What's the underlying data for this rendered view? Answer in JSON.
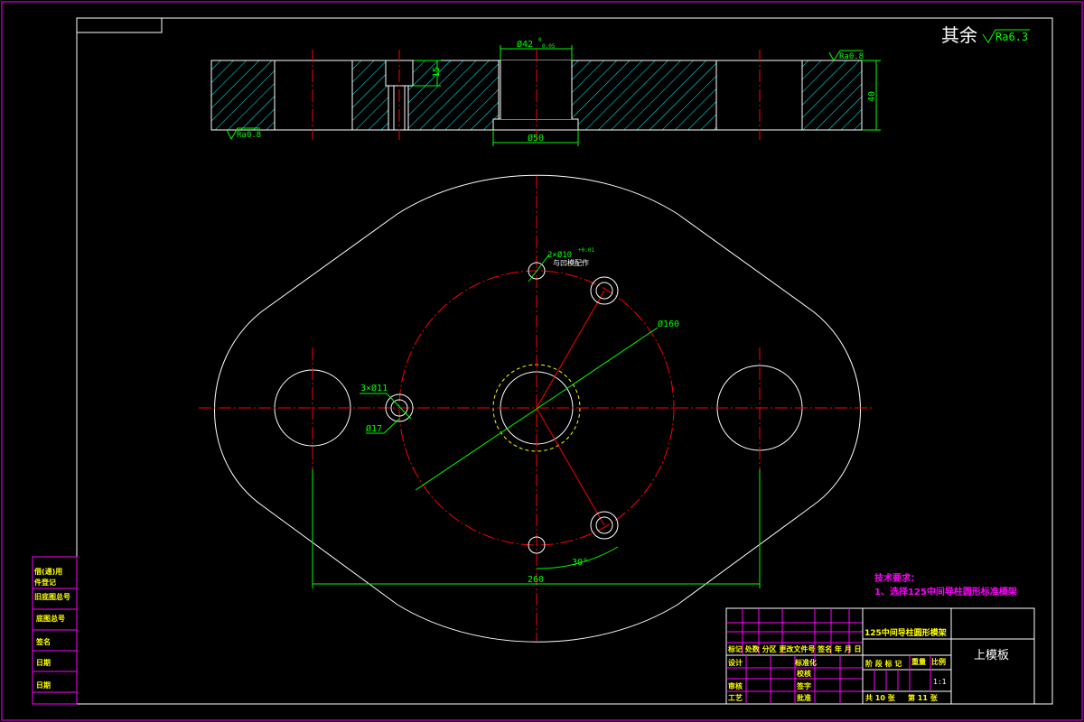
{
  "header": {
    "roughness_other_prefix": "其余",
    "roughness_other_value": "Ra6.3"
  },
  "section_view": {
    "bore_top_dim": "Ø42",
    "bore_top_tol_upper": "0",
    "bore_top_tol_lower": "0.05",
    "counterbore_depth": "15",
    "thickness": "40",
    "bottom_step_dim": "Ø50",
    "roughness_left": "Ra0.8",
    "roughness_right": "Ra0.8"
  },
  "plan_view": {
    "pin_hole_note": "2×Ø10",
    "pin_hole_tol": "+0.01",
    "pin_hole_note2": "与凹模配作",
    "pitch_circle": "Ø160",
    "screw_holes": "3×Ø11",
    "counterbore": "Ø17",
    "angle": "30°",
    "center_distance": "260"
  },
  "tech_requirements": {
    "title": "技术要求：",
    "item1": "1、选择125中间导柱圆形标准模架"
  },
  "title_block": {
    "part_name": "上模板",
    "standard_note": "125中间导柱圆形模架",
    "scale_label": "比例",
    "scale_value": "1:1",
    "mark_labels": "标记 处数 分区 更改文件号 签名 年 月 日",
    "design": "设计",
    "standardize": "标准化",
    "check": "审核",
    "process": "工艺",
    "proofread": "校核",
    "sign": "签字",
    "approve": "批准",
    "stage_labels": "阶 段 标 记",
    "weight": "重量",
    "sheets_total": "共 10 张",
    "sheet_no": "第 11 张"
  },
  "side_table": {
    "row1": "借(通)用",
    "row1b": "件登记",
    "row2": "旧底图总号",
    "row3": "底图总号",
    "row4": "签名",
    "row5": "日期",
    "row6": "日期"
  },
  "colors": {
    "frame": "#ff00ff",
    "outline": "#ffffff",
    "centerline": "#ff0000",
    "dimension": "#00ff00",
    "hatch": "#00ffff",
    "note": "#ff00ff",
    "hidden": "#ffff00"
  }
}
